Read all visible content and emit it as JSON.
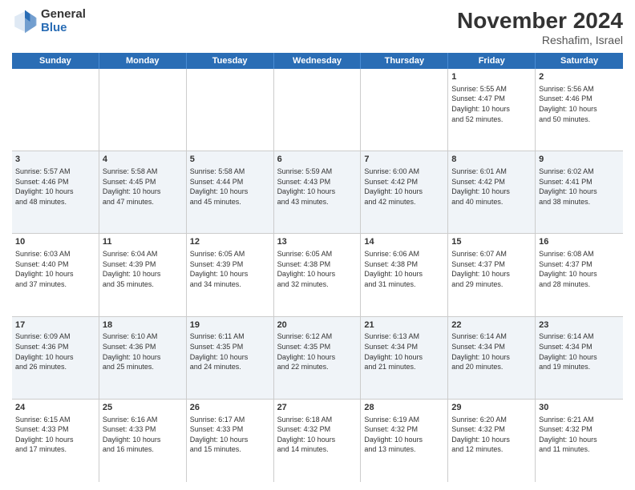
{
  "logo": {
    "general": "General",
    "blue": "Blue"
  },
  "header": {
    "title": "November 2024",
    "subtitle": "Reshafim, Israel"
  },
  "days_of_week": [
    "Sunday",
    "Monday",
    "Tuesday",
    "Wednesday",
    "Thursday",
    "Friday",
    "Saturday"
  ],
  "weeks": [
    [
      {
        "day": "",
        "info": ""
      },
      {
        "day": "",
        "info": ""
      },
      {
        "day": "",
        "info": ""
      },
      {
        "day": "",
        "info": ""
      },
      {
        "day": "",
        "info": ""
      },
      {
        "day": "1",
        "info": "Sunrise: 5:55 AM\nSunset: 4:47 PM\nDaylight: 10 hours\nand 52 minutes."
      },
      {
        "day": "2",
        "info": "Sunrise: 5:56 AM\nSunset: 4:46 PM\nDaylight: 10 hours\nand 50 minutes."
      }
    ],
    [
      {
        "day": "3",
        "info": "Sunrise: 5:57 AM\nSunset: 4:46 PM\nDaylight: 10 hours\nand 48 minutes."
      },
      {
        "day": "4",
        "info": "Sunrise: 5:58 AM\nSunset: 4:45 PM\nDaylight: 10 hours\nand 47 minutes."
      },
      {
        "day": "5",
        "info": "Sunrise: 5:58 AM\nSunset: 4:44 PM\nDaylight: 10 hours\nand 45 minutes."
      },
      {
        "day": "6",
        "info": "Sunrise: 5:59 AM\nSunset: 4:43 PM\nDaylight: 10 hours\nand 43 minutes."
      },
      {
        "day": "7",
        "info": "Sunrise: 6:00 AM\nSunset: 4:42 PM\nDaylight: 10 hours\nand 42 minutes."
      },
      {
        "day": "8",
        "info": "Sunrise: 6:01 AM\nSunset: 4:42 PM\nDaylight: 10 hours\nand 40 minutes."
      },
      {
        "day": "9",
        "info": "Sunrise: 6:02 AM\nSunset: 4:41 PM\nDaylight: 10 hours\nand 38 minutes."
      }
    ],
    [
      {
        "day": "10",
        "info": "Sunrise: 6:03 AM\nSunset: 4:40 PM\nDaylight: 10 hours\nand 37 minutes."
      },
      {
        "day": "11",
        "info": "Sunrise: 6:04 AM\nSunset: 4:39 PM\nDaylight: 10 hours\nand 35 minutes."
      },
      {
        "day": "12",
        "info": "Sunrise: 6:05 AM\nSunset: 4:39 PM\nDaylight: 10 hours\nand 34 minutes."
      },
      {
        "day": "13",
        "info": "Sunrise: 6:05 AM\nSunset: 4:38 PM\nDaylight: 10 hours\nand 32 minutes."
      },
      {
        "day": "14",
        "info": "Sunrise: 6:06 AM\nSunset: 4:38 PM\nDaylight: 10 hours\nand 31 minutes."
      },
      {
        "day": "15",
        "info": "Sunrise: 6:07 AM\nSunset: 4:37 PM\nDaylight: 10 hours\nand 29 minutes."
      },
      {
        "day": "16",
        "info": "Sunrise: 6:08 AM\nSunset: 4:37 PM\nDaylight: 10 hours\nand 28 minutes."
      }
    ],
    [
      {
        "day": "17",
        "info": "Sunrise: 6:09 AM\nSunset: 4:36 PM\nDaylight: 10 hours\nand 26 minutes."
      },
      {
        "day": "18",
        "info": "Sunrise: 6:10 AM\nSunset: 4:36 PM\nDaylight: 10 hours\nand 25 minutes."
      },
      {
        "day": "19",
        "info": "Sunrise: 6:11 AM\nSunset: 4:35 PM\nDaylight: 10 hours\nand 24 minutes."
      },
      {
        "day": "20",
        "info": "Sunrise: 6:12 AM\nSunset: 4:35 PM\nDaylight: 10 hours\nand 22 minutes."
      },
      {
        "day": "21",
        "info": "Sunrise: 6:13 AM\nSunset: 4:34 PM\nDaylight: 10 hours\nand 21 minutes."
      },
      {
        "day": "22",
        "info": "Sunrise: 6:14 AM\nSunset: 4:34 PM\nDaylight: 10 hours\nand 20 minutes."
      },
      {
        "day": "23",
        "info": "Sunrise: 6:14 AM\nSunset: 4:34 PM\nDaylight: 10 hours\nand 19 minutes."
      }
    ],
    [
      {
        "day": "24",
        "info": "Sunrise: 6:15 AM\nSunset: 4:33 PM\nDaylight: 10 hours\nand 17 minutes."
      },
      {
        "day": "25",
        "info": "Sunrise: 6:16 AM\nSunset: 4:33 PM\nDaylight: 10 hours\nand 16 minutes."
      },
      {
        "day": "26",
        "info": "Sunrise: 6:17 AM\nSunset: 4:33 PM\nDaylight: 10 hours\nand 15 minutes."
      },
      {
        "day": "27",
        "info": "Sunrise: 6:18 AM\nSunset: 4:32 PM\nDaylight: 10 hours\nand 14 minutes."
      },
      {
        "day": "28",
        "info": "Sunrise: 6:19 AM\nSunset: 4:32 PM\nDaylight: 10 hours\nand 13 minutes."
      },
      {
        "day": "29",
        "info": "Sunrise: 6:20 AM\nSunset: 4:32 PM\nDaylight: 10 hours\nand 12 minutes."
      },
      {
        "day": "30",
        "info": "Sunrise: 6:21 AM\nSunset: 4:32 PM\nDaylight: 10 hours\nand 11 minutes."
      }
    ]
  ]
}
